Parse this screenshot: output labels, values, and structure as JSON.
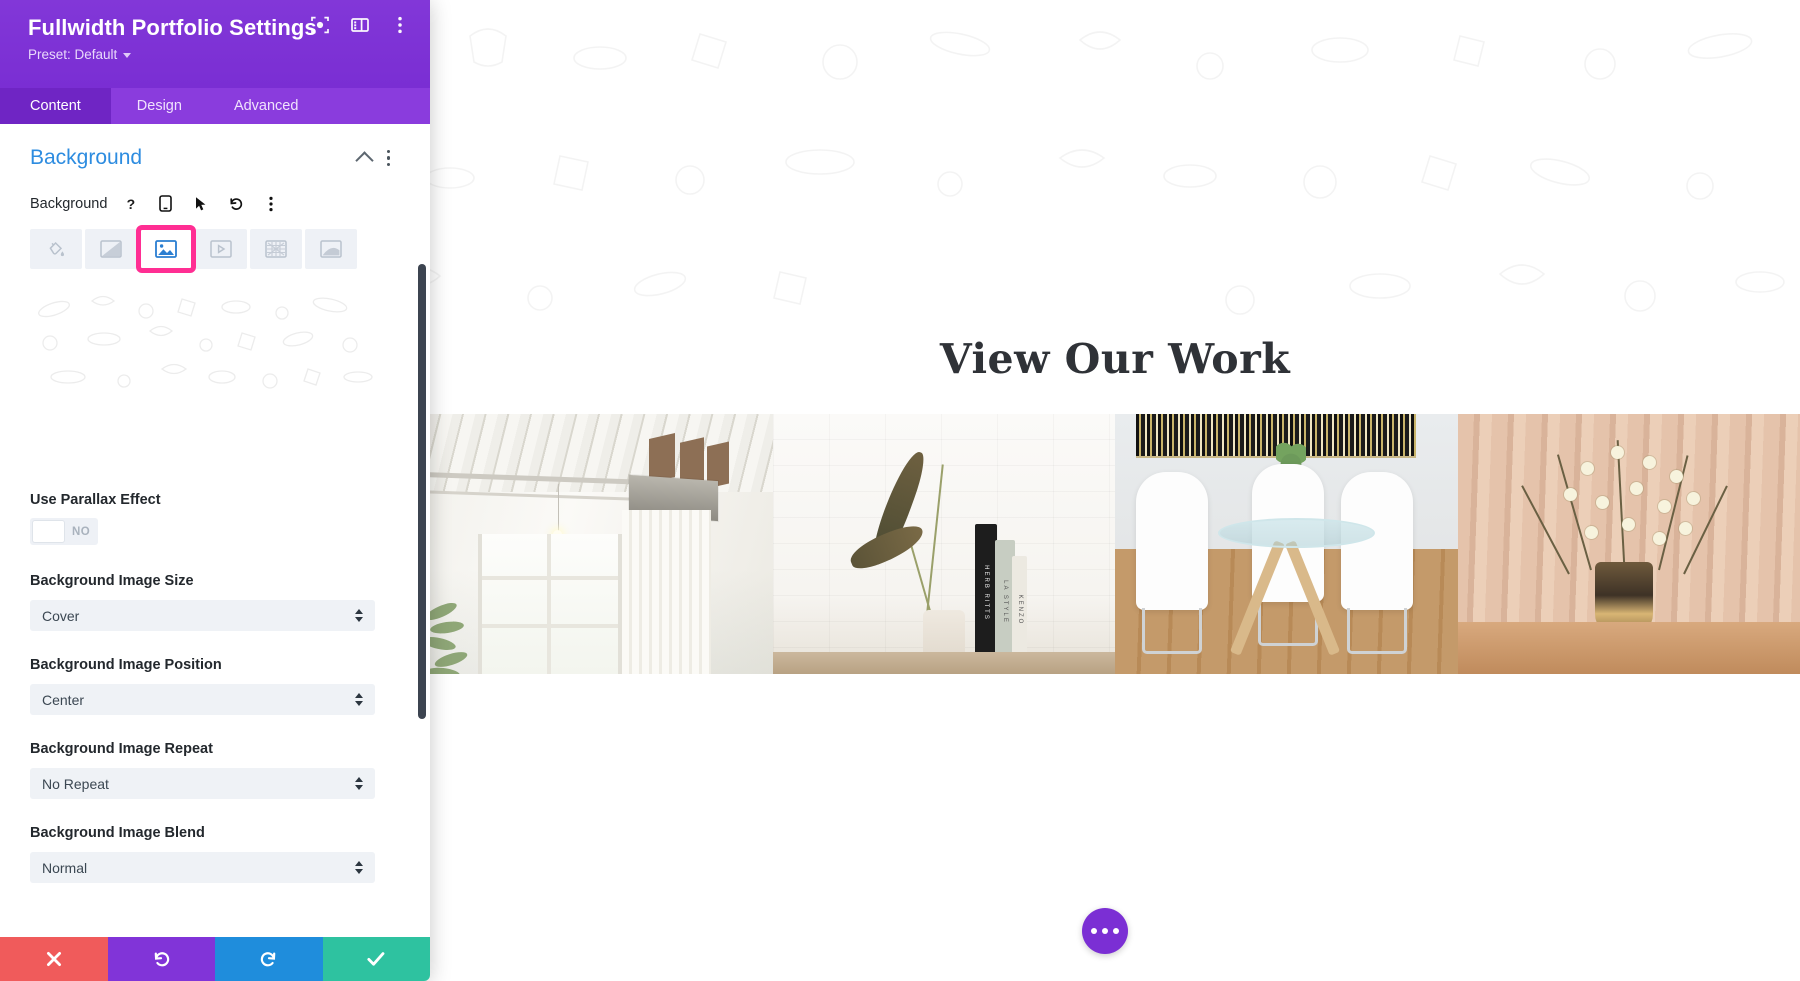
{
  "panel": {
    "title": "Fullwidth Portfolio Settings",
    "preset_label": "Preset: Default",
    "header_icons": [
      {
        "name": "focus-target-icon",
        "glyph": "focus"
      },
      {
        "name": "layout-panel-icon",
        "glyph": "layout"
      },
      {
        "name": "more-options-icon",
        "glyph": "kebab"
      }
    ],
    "tabs": [
      {
        "label": "Content",
        "active": true
      },
      {
        "label": "Design",
        "active": false
      },
      {
        "label": "Advanced",
        "active": false
      }
    ],
    "section": {
      "title": "Background",
      "collapse_icon": "chevron-up-icon",
      "options_icon": "section-options-icon"
    },
    "background_field": {
      "label": "Background",
      "mini_buttons": [
        {
          "name": "help-icon",
          "glyph": "?"
        },
        {
          "name": "responsive-phone-icon",
          "glyph": "phone"
        },
        {
          "name": "hover-cursor-icon",
          "glyph": "cursor"
        },
        {
          "name": "reset-icon",
          "glyph": "undo"
        },
        {
          "name": "field-options-icon",
          "glyph": "kebab"
        }
      ],
      "type_tabs": [
        {
          "name": "background-color-tab",
          "icon": "paint-bucket-icon",
          "selected": false
        },
        {
          "name": "background-gradient-tab",
          "icon": "gradient-icon",
          "selected": false
        },
        {
          "name": "background-image-tab",
          "icon": "image-icon",
          "selected": true
        },
        {
          "name": "background-video-tab",
          "icon": "video-icon",
          "selected": false
        },
        {
          "name": "background-pattern-tab",
          "icon": "pattern-icon",
          "selected": false
        },
        {
          "name": "background-mask-tab",
          "icon": "mask-icon",
          "selected": false
        }
      ]
    },
    "parallax": {
      "label": "Use Parallax Effect",
      "value": "NO",
      "enabled": false
    },
    "fields": [
      {
        "label": "Background Image Size",
        "value": "Cover",
        "name": "background-image-size-select"
      },
      {
        "label": "Background Image Position",
        "value": "Center",
        "name": "background-image-position-select"
      },
      {
        "label": "Background Image Repeat",
        "value": "No Repeat",
        "name": "background-image-repeat-select"
      },
      {
        "label": "Background Image Blend",
        "value": "Normal",
        "name": "background-image-blend-select"
      }
    ],
    "footer": [
      {
        "name": "discard-changes-button",
        "icon": "close-icon",
        "color": "#f05b5b"
      },
      {
        "name": "undo-button",
        "icon": "undo-icon",
        "color": "#8134d8"
      },
      {
        "name": "redo-button",
        "icon": "redo-icon",
        "color": "#1f8ddc"
      },
      {
        "name": "save-changes-button",
        "icon": "check-icon",
        "color": "#2ec2a0"
      }
    ]
  },
  "canvas": {
    "heading": "View Our Work",
    "portfolio_items": [
      {
        "name": "portfolio-image-loft-interior"
      },
      {
        "name": "portfolio-image-plant-and-books"
      },
      {
        "name": "portfolio-image-dining-set"
      },
      {
        "name": "portfolio-image-flower-arrangement"
      }
    ],
    "fab": {
      "name": "page-settings-fab",
      "icon": "ellipsis-icon"
    }
  },
  "colors": {
    "brand_purple": "#7b2fd4",
    "tab_purple": "#8a3cdd",
    "active_tab_purple": "#6f25c4",
    "section_blue": "#2d8ce0",
    "highlight_pink": "#ff2e93",
    "field_bg": "#eff2f6"
  }
}
